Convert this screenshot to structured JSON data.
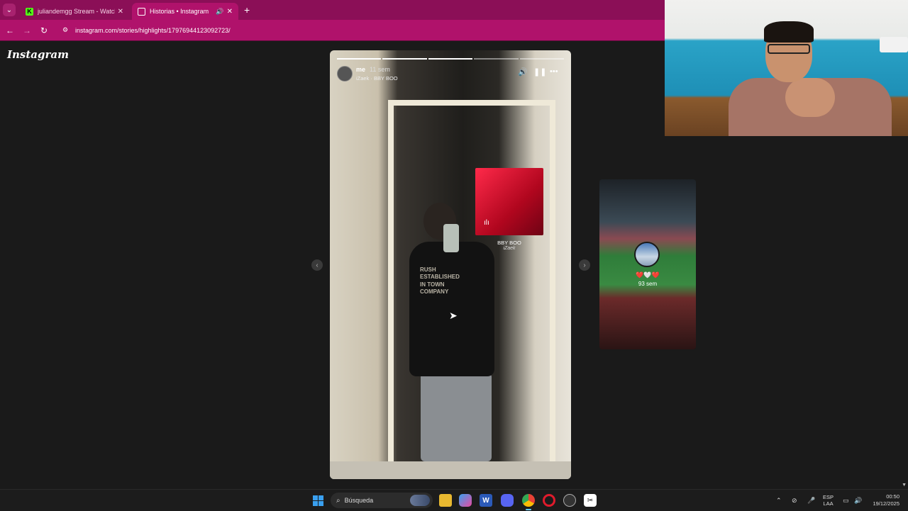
{
  "browser": {
    "tabs": [
      {
        "label": "juliandemgg Stream - Watch Li",
        "favicon": "kick-icon",
        "active": false
      },
      {
        "label": "Historias • Instagram",
        "favicon": "instagram-icon",
        "active": true
      }
    ],
    "tab_list_glyph": "⌄",
    "close_glyph": "✕",
    "audio_glyph": "🔊",
    "new_tab_glyph": "+",
    "kick_glyph": "K",
    "url": "instagram.com/stories/highlights/17976944123092723/",
    "back_glyph": "←",
    "forward_glyph": "→",
    "reload_glyph": "↻",
    "site_info_glyph": "⚙",
    "accent_color": "#b0126b"
  },
  "page": {
    "logo_text": "Instagram",
    "prev_glyph": "‹",
    "next_glyph": "›"
  },
  "story": {
    "progress_segments_total": 5,
    "progress_segments_done": 3,
    "username": "me",
    "time_ago": "11 sem",
    "music_line": "iZaek · BBY BOO",
    "mute_glyph": "🔊",
    "pause_glyph": "❚❚",
    "more_glyph": "•••",
    "shirt_text": "RUSH ESTABLISHED IN TOWN COMPANY",
    "music_sticker": {
      "title": "BBY BOO",
      "artist": "iZaek",
      "eq_glyph": "ılı"
    },
    "cursor_glyph": "➤"
  },
  "next_story": {
    "emojis": "❤️🤍❤️",
    "time_ago": "93 sem"
  },
  "taskbar": {
    "search_label": "Búsqueda",
    "search_glyph": "⌕",
    "word_glyph": "W",
    "capcut_glyph": "✂",
    "tray": {
      "up_glyph": "⌃",
      "net_glyph": "⊘",
      "mic_glyph": "🎤",
      "lang_line1": "ESP",
      "lang_line2": "LAA",
      "display_glyph": "▭",
      "volume_glyph": "🔊",
      "time": "00:50",
      "date": "19/12/2025"
    }
  },
  "scroll_down_glyph": "▼"
}
